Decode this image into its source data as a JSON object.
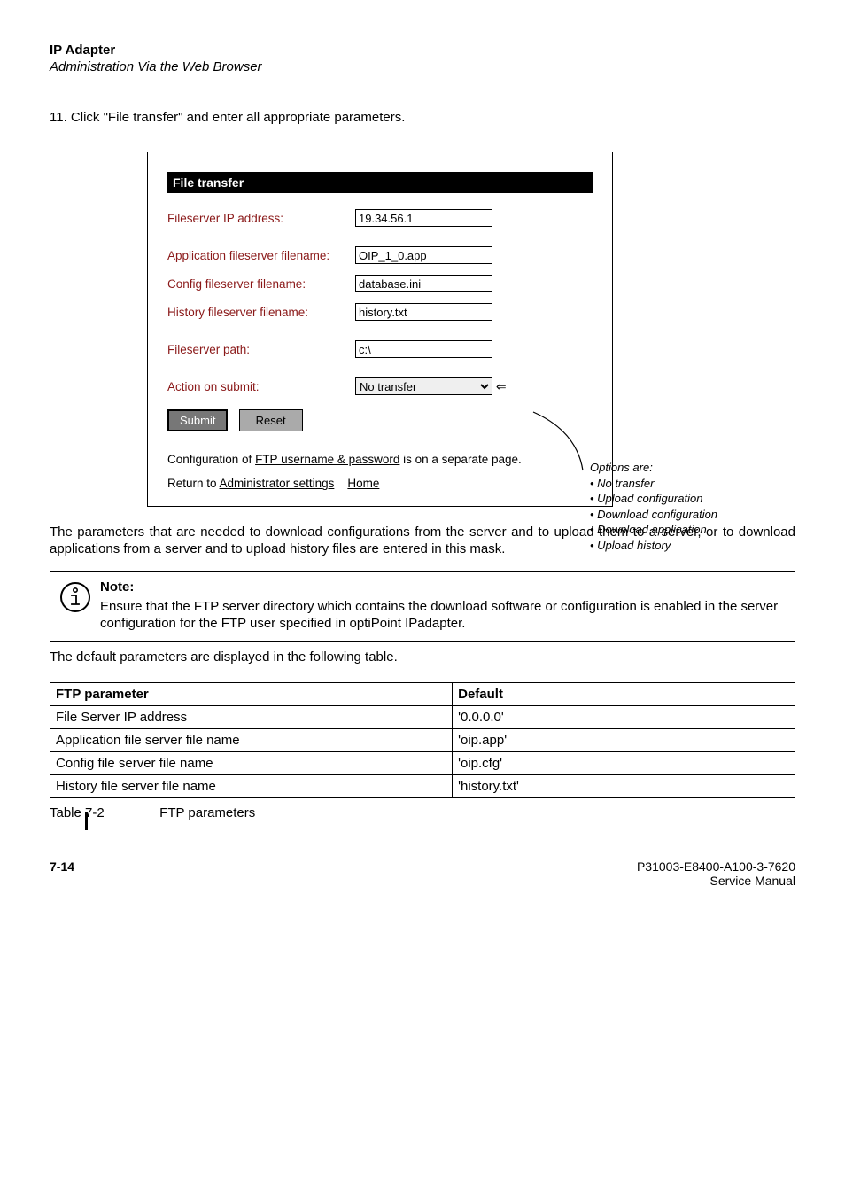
{
  "header": {
    "title": "IP Adapter",
    "subtitle": "Administration Via the Web Browser"
  },
  "step": {
    "number": "11.",
    "text": "Click \"File transfer\" and enter all appropriate parameters."
  },
  "form": {
    "section_title": "File transfer",
    "fileserver_ip_label": "Fileserver IP address:",
    "fileserver_ip_value": "19.34.56.1",
    "app_file_label": "Application fileserver filename:",
    "app_file_value": "OIP_1_0.app",
    "config_file_label": "Config fileserver filename:",
    "config_file_value": "database.ini",
    "history_file_label": "History fileserver filename:",
    "history_file_value": "history.txt",
    "fileserver_path_label": "Fileserver path:",
    "fileserver_path_value": "c:\\",
    "action_label": "Action on submit:",
    "action_value": "No transfer",
    "submit_label": "Submit",
    "reset_label": "Reset",
    "config_note_prefix": "Configuration of ",
    "config_note_link": "FTP username & password",
    "config_note_suffix": " is on a separate page.",
    "return_prefix": "Return to ",
    "return_link1": "Administrator settings",
    "return_link2": "Home"
  },
  "callout": {
    "title": "Options are:",
    "items": [
      "No transfer",
      "Upload configuration",
      "Download configuration",
      "Download application",
      "Upload history"
    ]
  },
  "paragraph": "The parameters that are needed to download configurations from the server and to upload them to a server, or to download applications from a server and to upload history files are entered in this mask.",
  "note": {
    "title": "Note:",
    "body": "Ensure that the FTP server directory which contains the download software or configuration is enabled in the server configuration for the FTP user specified in optiPoint IPadapter."
  },
  "defaults_intro": "The default parameters are displayed in the following table.",
  "table": {
    "header_param": "FTP parameter",
    "header_default": "Default",
    "rows": [
      {
        "param": "File Server IP address",
        "default": "'0.0.0.0'"
      },
      {
        "param": "Application file server file name",
        "default": "'oip.app'"
      },
      {
        "param": "Config file server file name",
        "default": "'oip.cfg'"
      },
      {
        "param": "History file server file name",
        "default": "'history.txt'"
      }
    ]
  },
  "table_caption": {
    "label": "Table 7-2",
    "text": "FTP parameters"
  },
  "footer": {
    "page": "7-14",
    "doc": "P31003-E8400-A100-3-7620",
    "type": "Service Manual"
  }
}
